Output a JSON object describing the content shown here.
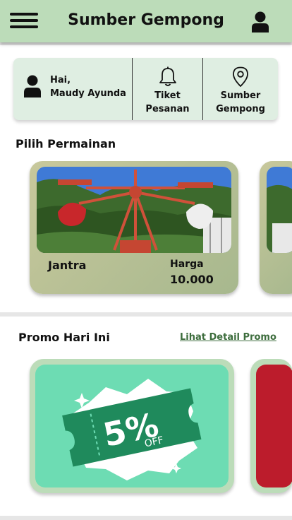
{
  "app": {
    "title": "Sumber Gempong"
  },
  "user_card": {
    "greeting": "Hai,",
    "name": "Maudy Ayunda",
    "ticket_line1": "Tiket",
    "ticket_line2": "Pesanan",
    "location_line1": "Sumber",
    "location_line2": "Gempong"
  },
  "games": {
    "section_title": "Pilih Permainan",
    "items": [
      {
        "name": "Jantra",
        "price_label": "Harga",
        "price": "10.000"
      }
    ]
  },
  "promo": {
    "section_title": "Promo Hari Ini",
    "detail_link": "Lihat Detail Promo",
    "coupon_percent": "5%",
    "coupon_off": "OFF"
  },
  "colors": {
    "header": "#bcdcb9",
    "card": "#dfeee2",
    "promo_inner": "#6ddcb3",
    "coupon": "#1f8a5c",
    "link": "#3d6d3d",
    "accent_red": "#bc1c2c"
  },
  "icons": [
    "menu-icon",
    "user-icon",
    "bell-icon",
    "map-pin-icon",
    "sparkle-icon"
  ]
}
